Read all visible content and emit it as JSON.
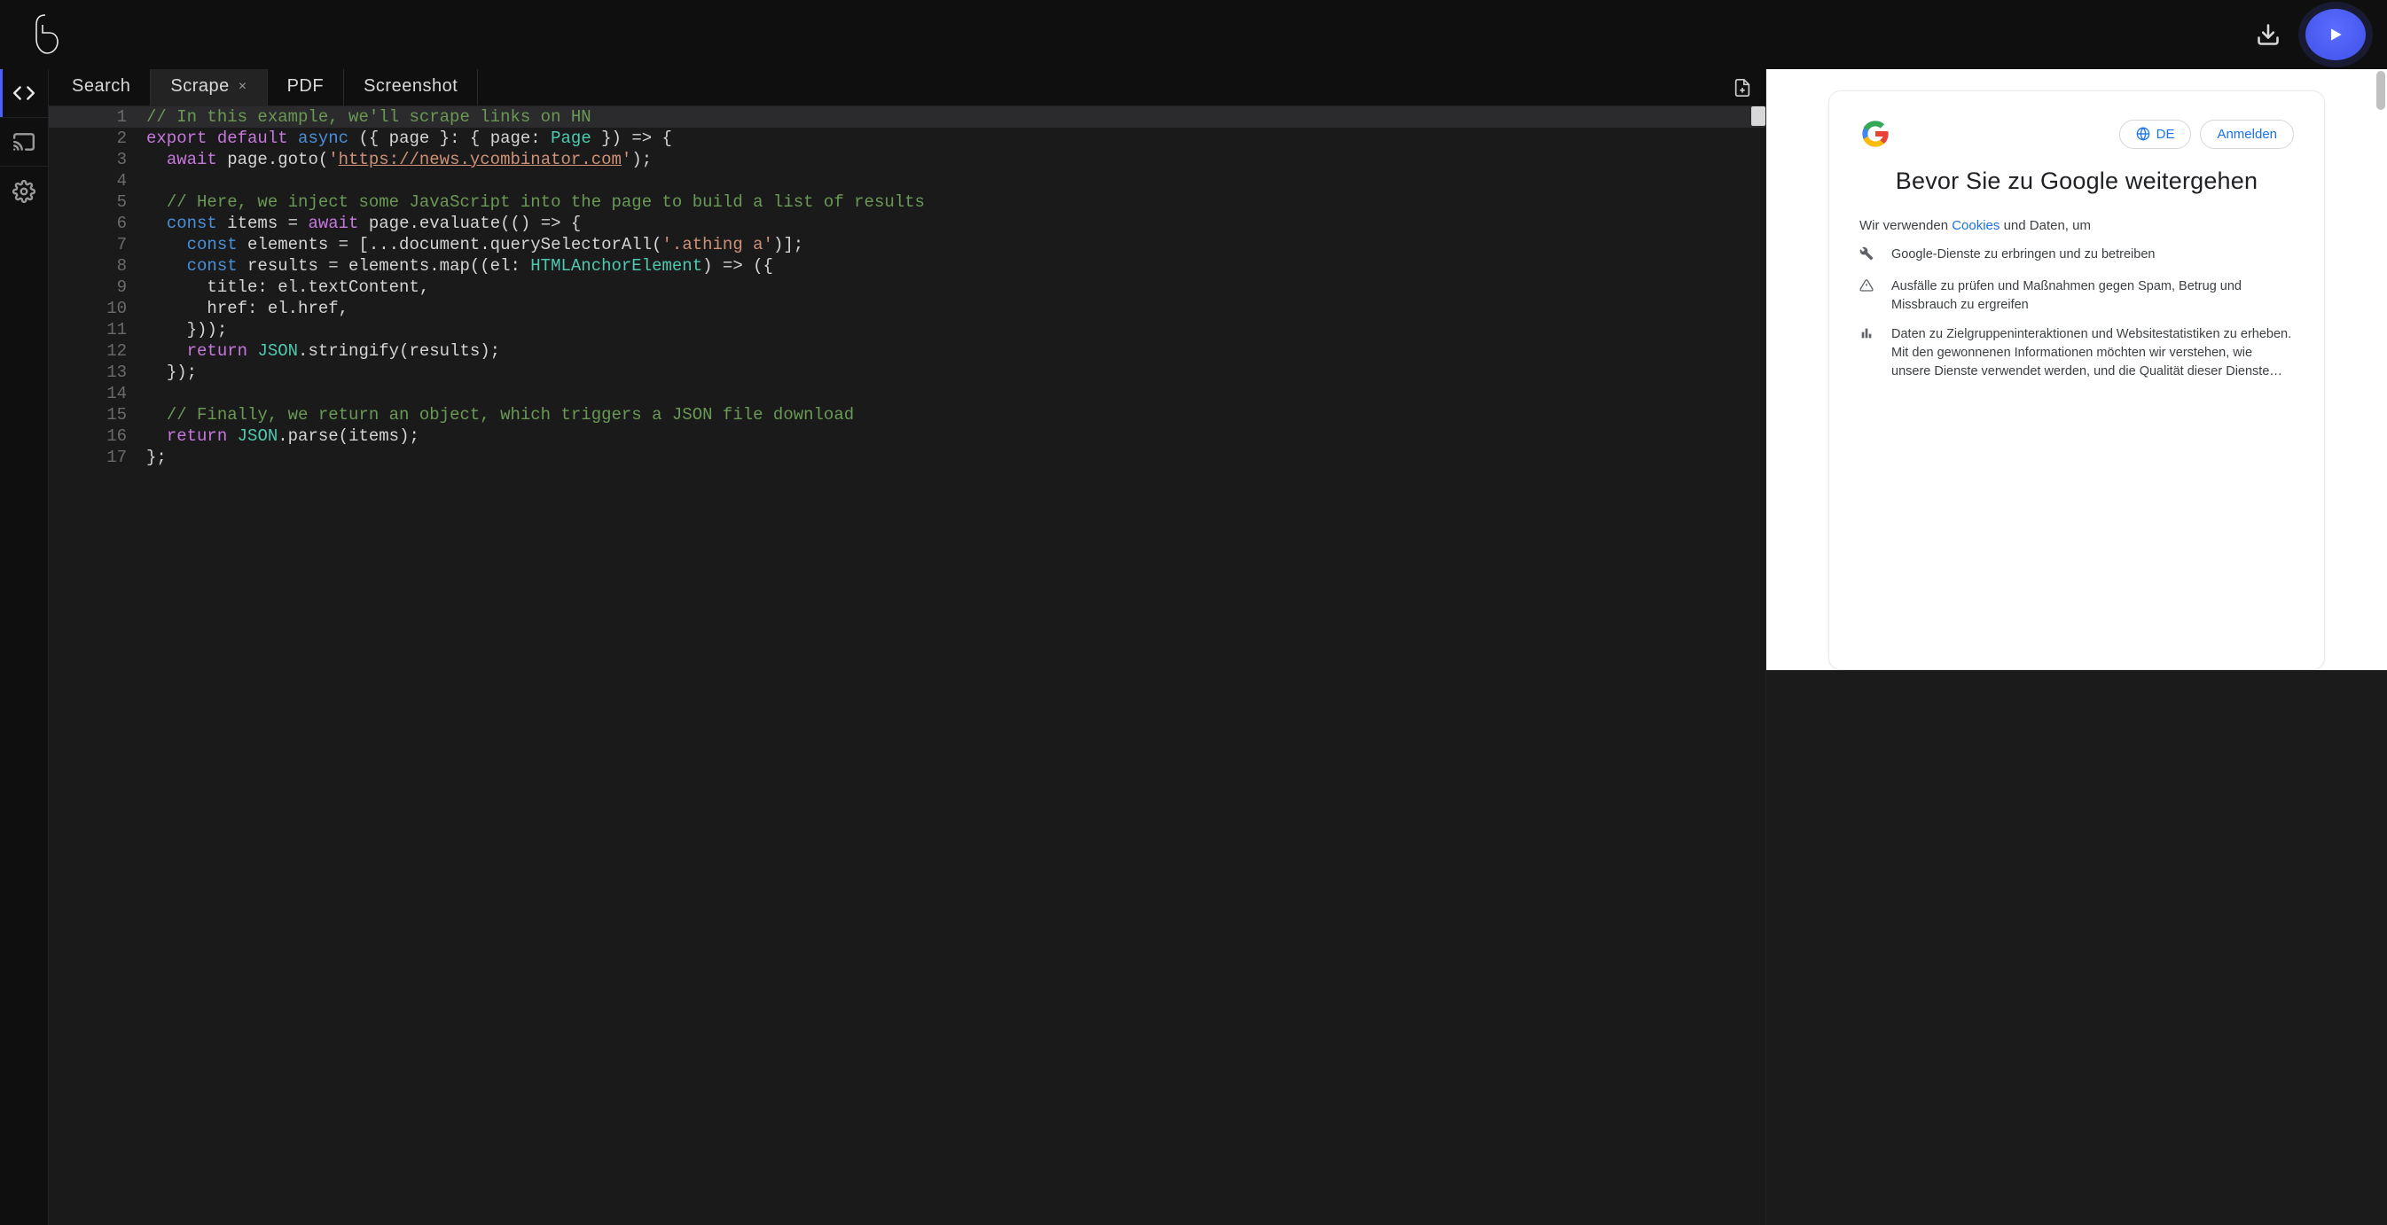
{
  "header": {
    "logo_label": "playground-logo"
  },
  "rail": {
    "items": [
      {
        "name": "code-view-icon",
        "active": true
      },
      {
        "name": "cast-icon",
        "active": false
      },
      {
        "name": "settings-icon",
        "active": false
      }
    ]
  },
  "tabs": [
    {
      "label": "Search",
      "active": false,
      "close": false
    },
    {
      "label": "Scrape",
      "active": true,
      "close": true
    },
    {
      "label": "PDF",
      "active": false,
      "close": false
    },
    {
      "label": "Screenshot",
      "active": false,
      "close": false
    }
  ],
  "editor": {
    "lines": [
      {
        "n": 1,
        "tokens": [
          {
            "c": "tk-comment",
            "t": "// In this example, we'll scrape links on HN"
          }
        ]
      },
      {
        "n": 2,
        "tokens": [
          {
            "c": "tk-keyword",
            "t": "export default"
          },
          {
            "c": "tk-plain",
            "t": " "
          },
          {
            "c": "tk-keyword2",
            "t": "async"
          },
          {
            "c": "tk-plain",
            "t": " ({ page }: { page: "
          },
          {
            "c": "tk-type",
            "t": "Page"
          },
          {
            "c": "tk-plain",
            "t": " }) => {"
          }
        ]
      },
      {
        "n": 3,
        "tokens": [
          {
            "c": "tk-plain",
            "t": "  "
          },
          {
            "c": "tk-keyword",
            "t": "await"
          },
          {
            "c": "tk-plain",
            "t": " page.goto("
          },
          {
            "c": "tk-string",
            "t": "'"
          },
          {
            "c": "tk-string-link",
            "t": "https://news.ycombinator.com"
          },
          {
            "c": "tk-string",
            "t": "'"
          },
          {
            "c": "tk-plain",
            "t": ");"
          }
        ]
      },
      {
        "n": 4,
        "tokens": [
          {
            "c": "tk-plain",
            "t": ""
          }
        ]
      },
      {
        "n": 5,
        "tokens": [
          {
            "c": "tk-plain",
            "t": "  "
          },
          {
            "c": "tk-comment",
            "t": "// Here, we inject some JavaScript into the page to build a list of results"
          }
        ]
      },
      {
        "n": 6,
        "tokens": [
          {
            "c": "tk-plain",
            "t": "  "
          },
          {
            "c": "tk-keyword2",
            "t": "const"
          },
          {
            "c": "tk-plain",
            "t": " items = "
          },
          {
            "c": "tk-keyword",
            "t": "await"
          },
          {
            "c": "tk-plain",
            "t": " page.evaluate(() => {"
          }
        ]
      },
      {
        "n": 7,
        "tokens": [
          {
            "c": "tk-plain",
            "t": "    "
          },
          {
            "c": "tk-keyword2",
            "t": "const"
          },
          {
            "c": "tk-plain",
            "t": " elements = [...document.querySelectorAll("
          },
          {
            "c": "tk-string",
            "t": "'.athing a'"
          },
          {
            "c": "tk-plain",
            "t": ")];"
          }
        ]
      },
      {
        "n": 8,
        "tokens": [
          {
            "c": "tk-plain",
            "t": "    "
          },
          {
            "c": "tk-keyword2",
            "t": "const"
          },
          {
            "c": "tk-plain",
            "t": " results = elements.map((el: "
          },
          {
            "c": "tk-type",
            "t": "HTMLAnchorElement"
          },
          {
            "c": "tk-plain",
            "t": ") => ({"
          }
        ]
      },
      {
        "n": 9,
        "tokens": [
          {
            "c": "tk-plain",
            "t": "      title: el.textContent,"
          }
        ]
      },
      {
        "n": 10,
        "tokens": [
          {
            "c": "tk-plain",
            "t": "      href: el.href,"
          }
        ]
      },
      {
        "n": 11,
        "tokens": [
          {
            "c": "tk-plain",
            "t": "    }));"
          }
        ]
      },
      {
        "n": 12,
        "tokens": [
          {
            "c": "tk-plain",
            "t": "    "
          },
          {
            "c": "tk-keyword",
            "t": "return"
          },
          {
            "c": "tk-plain",
            "t": " "
          },
          {
            "c": "tk-json",
            "t": "JSON"
          },
          {
            "c": "tk-plain",
            "t": ".stringify(results);"
          }
        ]
      },
      {
        "n": 13,
        "tokens": [
          {
            "c": "tk-plain",
            "t": "  });"
          }
        ]
      },
      {
        "n": 14,
        "tokens": [
          {
            "c": "tk-plain",
            "t": ""
          }
        ]
      },
      {
        "n": 15,
        "tokens": [
          {
            "c": "tk-plain",
            "t": "  "
          },
          {
            "c": "tk-comment",
            "t": "// Finally, we return an object, which triggers a JSON file download"
          }
        ]
      },
      {
        "n": 16,
        "tokens": [
          {
            "c": "tk-plain",
            "t": "  "
          },
          {
            "c": "tk-keyword",
            "t": "return"
          },
          {
            "c": "tk-plain",
            "t": " "
          },
          {
            "c": "tk-json",
            "t": "JSON"
          },
          {
            "c": "tk-plain",
            "t": ".parse(items);"
          }
        ]
      },
      {
        "n": 17,
        "tokens": [
          {
            "c": "tk-plain",
            "t": "};"
          }
        ]
      }
    ]
  },
  "preview": {
    "lang_label": "DE",
    "signin_label": "Anmelden",
    "title": "Bevor Sie zu Google weitergehen",
    "intro_prefix": "Wir verwenden ",
    "intro_link": "Cookies",
    "intro_suffix": " und Daten, um",
    "bullets": [
      {
        "icon": "tools-icon",
        "text": "Google-Dienste zu erbringen und zu betreiben"
      },
      {
        "icon": "warning-icon",
        "text": "Ausfälle zu prüfen und Maßnahmen gegen Spam, Betrug und Missbrauch zu ergreifen"
      },
      {
        "icon": "chart-icon",
        "text": "Daten zu Zielgruppeninteraktionen und Websitestatistiken zu erheben. Mit den gewonnenen Informationen möchten wir verstehen, wie unsere Dienste verwendet werden, und die Qualität dieser Dienste verbessern."
      }
    ]
  }
}
